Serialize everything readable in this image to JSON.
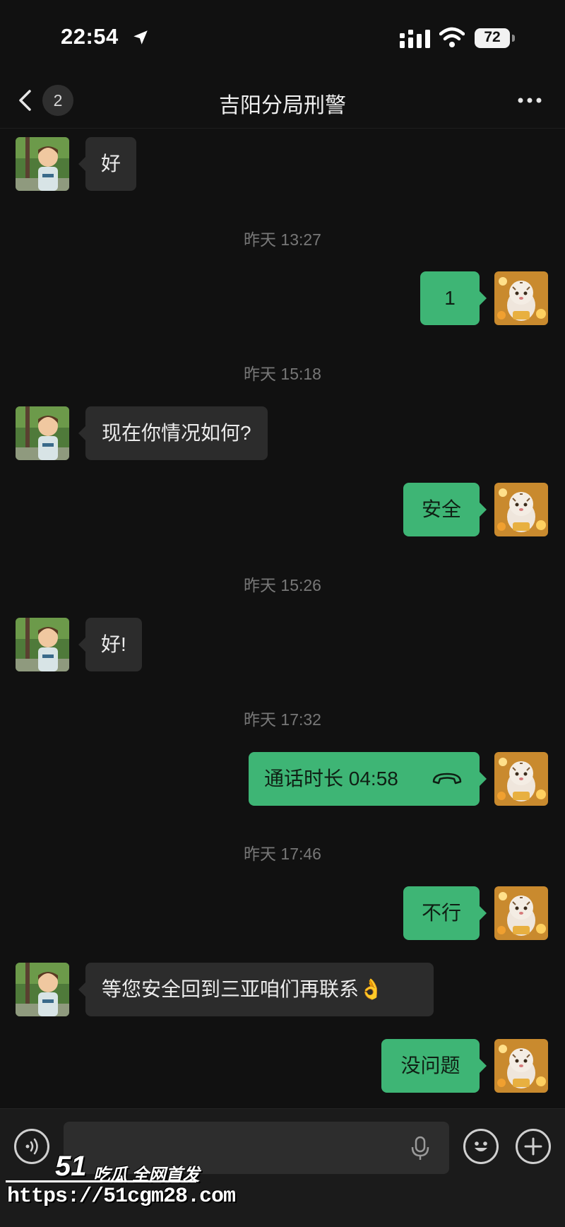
{
  "status": {
    "time": "22:54",
    "battery": "72"
  },
  "nav": {
    "back_badge": "2",
    "title": "吉阳分局刑警"
  },
  "messages": [
    {
      "side": "in",
      "text": "好"
    },
    {
      "side": "time",
      "text": "昨天 13:27"
    },
    {
      "side": "out",
      "text": "1"
    },
    {
      "side": "time",
      "text": "昨天 15:18"
    },
    {
      "side": "in",
      "text": "现在你情况如何?"
    },
    {
      "side": "out",
      "text": "安全"
    },
    {
      "side": "time",
      "text": "昨天 15:26"
    },
    {
      "side": "in",
      "text": "好!"
    },
    {
      "side": "time",
      "text": "昨天 17:32"
    },
    {
      "side": "out",
      "text": "通话时长 04:58",
      "icon": "phone-hangup-icon"
    },
    {
      "side": "time",
      "text": "昨天 17:46"
    },
    {
      "side": "out",
      "text": "不行"
    },
    {
      "side": "in",
      "text": "等您安全回到三亚咱们再联系",
      "emoji": "👌"
    },
    {
      "side": "out",
      "text": "没问题"
    }
  ],
  "input": {
    "value": "",
    "placeholder": ""
  },
  "watermark": {
    "logo": "51",
    "slogan": "吃瓜 全网首发",
    "url": "https://51cgm28.com"
  },
  "colors": {
    "background": "#111111",
    "outgoing_bubble": "#3eb575",
    "incoming_bubble": "#2c2c2c"
  }
}
